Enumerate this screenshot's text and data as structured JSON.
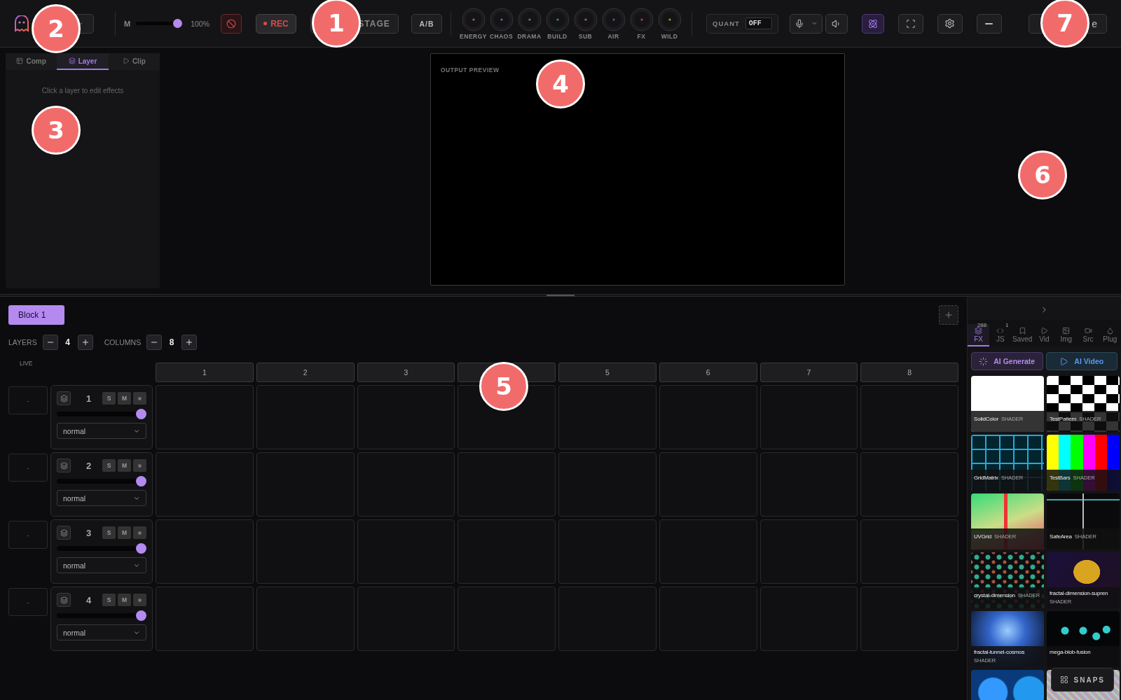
{
  "topbar": {
    "slider": {
      "label": "M",
      "level": 1,
      "reading": "100%"
    },
    "rec": "REC",
    "stage": "STAGE",
    "ab": "A/B",
    "knobs": [
      {
        "label": "ENERGY",
        "color": "#c0603a"
      },
      {
        "label": "CHAOS",
        "color": "#5a70b0"
      },
      {
        "label": "DRAMA",
        "color": "#7a6ab0"
      },
      {
        "label": "BUILD",
        "color": "#3a9a50"
      },
      {
        "label": "SUB",
        "color": "#c06030"
      },
      {
        "label": "AIR",
        "color": "#4060b0"
      },
      {
        "label": "FX",
        "color": "#b04050"
      },
      {
        "label": "WILD",
        "color": "#b09030"
      }
    ],
    "quant": {
      "label": "QUANT",
      "value": "OFF"
    },
    "last_button": "e"
  },
  "inspector": {
    "tabs": [
      {
        "label": "Comp",
        "selected": false
      },
      {
        "label": "Layer",
        "selected": true
      },
      {
        "label": "Clip",
        "selected": false
      }
    ],
    "hint": "Click a layer to edit effects"
  },
  "preview": {
    "label": "OUTPUT PREVIEW"
  },
  "blocks": [
    {
      "label": "Block 1",
      "selected": true
    }
  ],
  "counts": {
    "layers_label": "LAYERS",
    "layers": "4",
    "columns_label": "COLUMNS",
    "columns": "8"
  },
  "live_label": "LIVE",
  "columns": [
    {
      "label": "1"
    },
    {
      "label": "2"
    },
    {
      "label": "3"
    },
    {},
    {
      "label": "5"
    },
    {
      "label": "6"
    },
    {
      "label": "7"
    },
    {
      "label": "8"
    }
  ],
  "layers": [
    {
      "number": "1",
      "live": "-",
      "solo": "S",
      "mute": "M",
      "level": 1,
      "blend": "normal"
    },
    {
      "number": "2",
      "live": "-",
      "solo": "S",
      "mute": "M",
      "level": 1,
      "blend": "normal"
    },
    {
      "number": "3",
      "live": "-",
      "solo": "S",
      "mute": "M",
      "level": 1,
      "blend": "normal"
    },
    {
      "number": "4",
      "live": "-",
      "solo": "S",
      "mute": "M",
      "level": 1,
      "blend": "normal"
    }
  ],
  "browser": {
    "tabs": [
      {
        "label": "FX",
        "badge": "288",
        "selected": true
      },
      {
        "label": "JS",
        "badge": "1",
        "selected": false
      },
      {
        "label": "Saved",
        "selected": false
      },
      {
        "label": "Vid",
        "selected": false
      },
      {
        "label": "Img",
        "selected": false
      },
      {
        "label": "Src",
        "selected": false
      },
      {
        "label": "Plug",
        "selected": false
      }
    ],
    "ai_buttons": [
      {
        "label": "AI Generate",
        "kind": "generate"
      },
      {
        "label": "AI Video",
        "kind": "video"
      }
    ],
    "items": [
      {
        "name": "SolidColor",
        "type": "SHADER",
        "kind": "solid"
      },
      {
        "name": "TestPattern",
        "type": "SHADER",
        "kind": "checker"
      },
      {
        "name": "GridMatrix",
        "type": "SHADER",
        "kind": "grid"
      },
      {
        "name": "TestBars",
        "type": "SHADER",
        "kind": "bars"
      },
      {
        "name": "UVGrid",
        "type": "SHADER",
        "kind": "uv"
      },
      {
        "name": "SafeArea",
        "type": "SHADER",
        "kind": "safe"
      },
      {
        "name": "crystal-dimension",
        "type": "SHADER",
        "kind": "crystal"
      },
      {
        "name": "fractal-dimension-supren",
        "type": "SHADER",
        "kind": "fractal"
      },
      {
        "name": "fractal-tunnel-cosmos",
        "type": "SHADER",
        "kind": "tunnel"
      },
      {
        "name": "mega-blob-fusion",
        "kind": "blobs"
      },
      {
        "kind": "bubbles"
      },
      {
        "kind": "noise"
      }
    ]
  },
  "snaps": "SNAPS",
  "callouts": [
    "2",
    "1",
    "7",
    "3",
    "4",
    "6",
    "5"
  ]
}
